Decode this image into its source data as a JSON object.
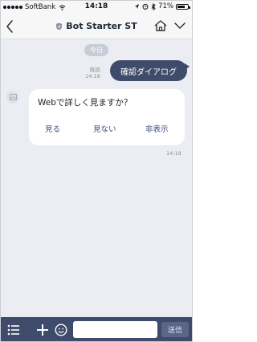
{
  "status_bar": {
    "carrier": "SoftBank",
    "time": "14:18",
    "battery_percent": "71%",
    "battery_level": 0.71,
    "icons": [
      "signal-dots-icon",
      "wifi-icon",
      "location-icon",
      "alarm-icon",
      "bluetooth-icon",
      "battery-icon"
    ]
  },
  "header": {
    "title": "Bot Starter ST",
    "icons": [
      "back-chevron-icon",
      "shield-icon",
      "home-icon",
      "chevron-down-icon"
    ]
  },
  "chat": {
    "date_label": "今日",
    "outgoing": {
      "text": "確認ダイアログ",
      "read_label": "既読",
      "time": "14:18"
    },
    "incoming_card": {
      "text": "Webで詳しく見ますか？",
      "actions": [
        "見る",
        "見ない",
        "非表示"
      ],
      "time": "14:18"
    }
  },
  "input_bar": {
    "placeholder": "",
    "send_label": "送信",
    "icons": [
      "menu-list-icon",
      "plus-icon",
      "emoji-icon"
    ]
  },
  "colors": {
    "accent_navy": "#3f4b6a",
    "chat_background": "#ebedf2",
    "action_text": "#3a4a86"
  }
}
